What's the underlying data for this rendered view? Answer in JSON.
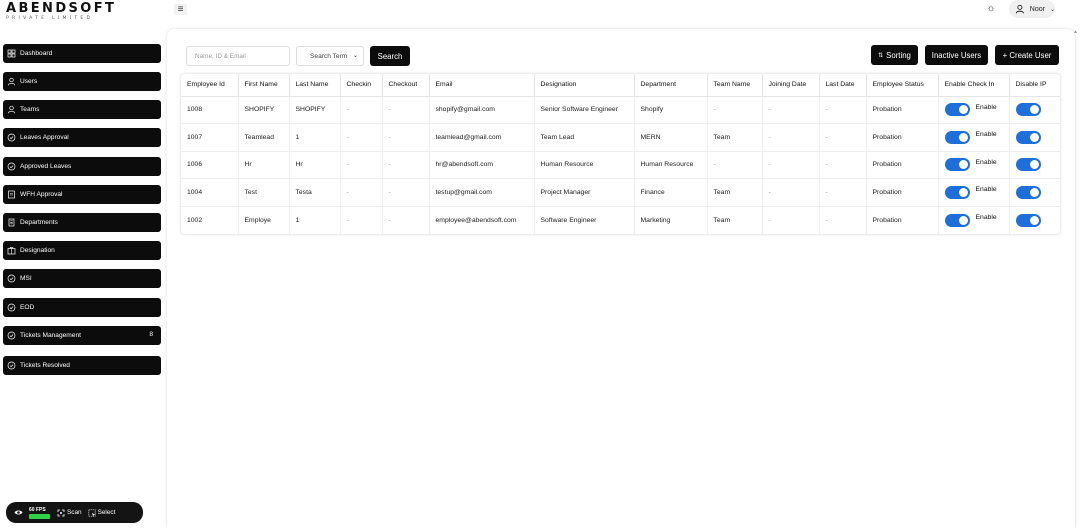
{
  "brand": {
    "name": "ABENDSOFT",
    "tagline": "PRIVATE LIMITED"
  },
  "header": {
    "menu_icon": "hamburger-icon",
    "theme_icon": "sun-icon",
    "user_name": "Noor"
  },
  "sidebar": {
    "items": [
      {
        "label": "Dashboard",
        "icon": "dashboard-icon"
      },
      {
        "label": "Users",
        "icon": "users-icon"
      },
      {
        "label": "Teams",
        "icon": "teams-icon"
      },
      {
        "label": "Leaves Approval",
        "icon": "check-circle-icon"
      },
      {
        "label": "Approved Leaves",
        "icon": "check-circle-icon"
      },
      {
        "label": "WFH Approval",
        "icon": "document-icon"
      },
      {
        "label": "Departments",
        "icon": "building-icon"
      },
      {
        "label": "Designation",
        "icon": "briefcase-icon"
      },
      {
        "label": "MSI",
        "icon": "check-circle-icon"
      },
      {
        "label": "EOD",
        "icon": "check-circle-icon"
      },
      {
        "label": "Tickets Management",
        "icon": "check-circle-icon",
        "badge": "8"
      },
      {
        "label": "Tickets Resolved",
        "icon": "check-circle-icon"
      }
    ]
  },
  "perf": {
    "fps": "60 FPS",
    "scan": "Scan",
    "select": "Select"
  },
  "toolbar": {
    "search_placeholder": "Name, ID & Email",
    "search_term": "Search Term",
    "search_button": "Search",
    "sorting_button": "Sorting",
    "inactive_button": "Inactive Users",
    "create_button": "+ Create User"
  },
  "table": {
    "columns": [
      "Employee Id",
      "First Name",
      "Last Name",
      "Checkin",
      "Checkout",
      "Email",
      "Designation",
      "Department",
      "Team Name",
      "Joining Date",
      "Last Date",
      "Employee Status",
      "Enable Check In",
      "Disable IP"
    ],
    "toggle_label": "Enable",
    "rows": [
      [
        "1008",
        "SHOPIFY",
        "SHOPIFY",
        "-",
        "-",
        "shopify@gmail.com",
        "Senior Software Engineer",
        "Shopify",
        "-",
        "-",
        "-",
        "Probation"
      ],
      [
        "1007",
        "Teamlead",
        "1",
        "-",
        "-",
        "teamlead@gmail.com",
        "Team Lead",
        "MERN",
        "Team",
        "-",
        "-",
        "Probation"
      ],
      [
        "1006",
        "Hr",
        "Hr",
        "-",
        "-",
        "hr@abendsoft.com",
        "Human Resource",
        "Human Resource",
        "-",
        "-",
        "-",
        "Probation"
      ],
      [
        "1004",
        "Test",
        "Testa",
        "-",
        "-",
        "testup@gmail.com",
        "Project Manager",
        "Finance",
        "Team",
        "-",
        "-",
        "Probation"
      ],
      [
        "1002",
        "Employe",
        "1",
        "-",
        "-",
        "employee@abendsoft.com",
        "Software Engineer",
        "Marketing",
        "Team",
        "-",
        "-",
        "Probation"
      ]
    ]
  },
  "colors": {
    "accent": "#1e6fd9",
    "dark": "#0c0c0c",
    "fps_green": "#2fd14a"
  }
}
